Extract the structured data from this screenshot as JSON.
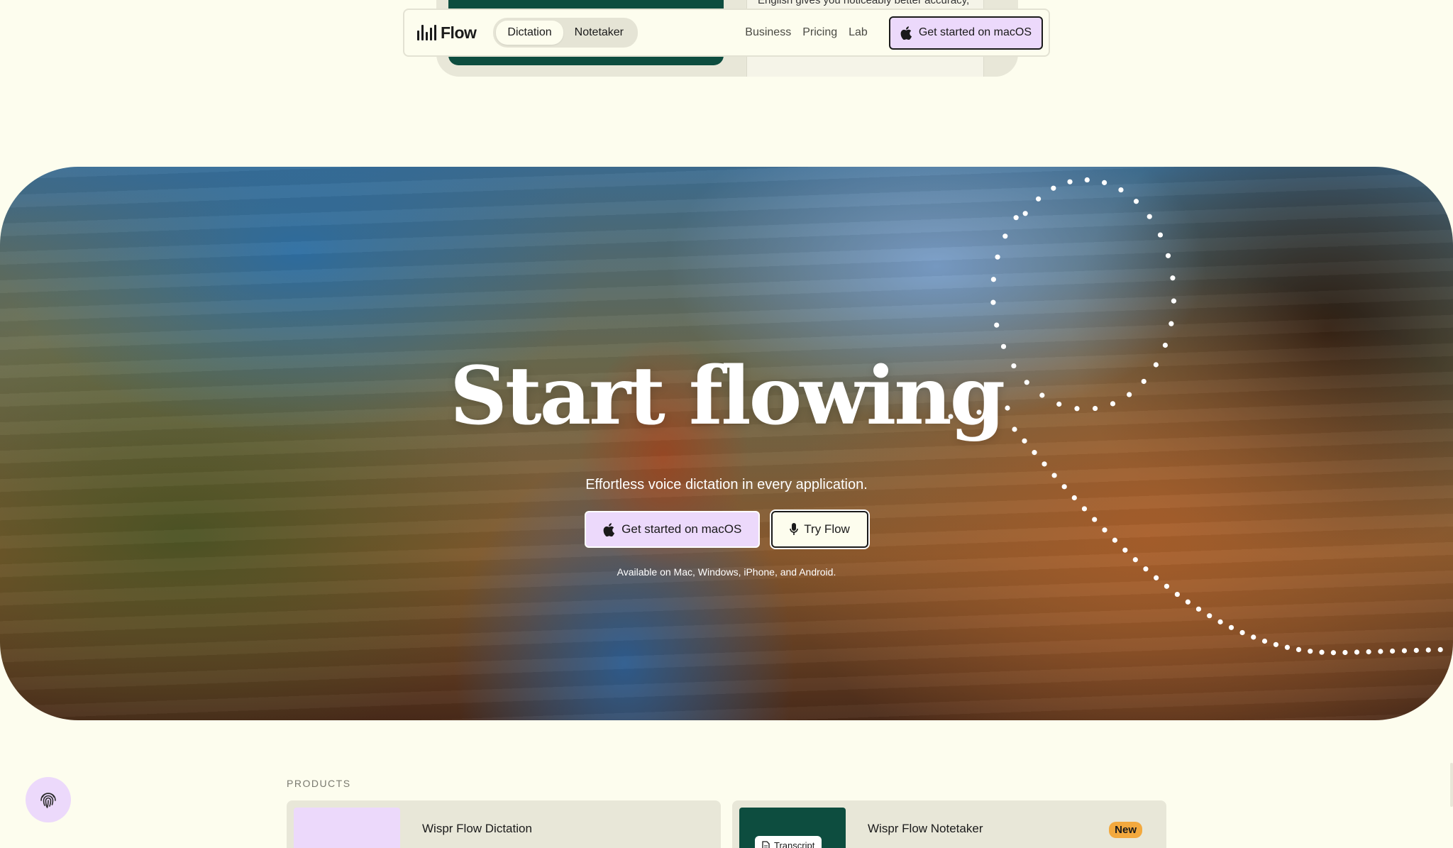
{
  "peek": {
    "doc_text": "English gives you noticeably better accuracy,"
  },
  "nav": {
    "logo_text": "Flow",
    "segments": [
      "Dictation",
      "Notetaker"
    ],
    "active_segment": "Dictation",
    "links": [
      "Business",
      "Pricing",
      "Lab"
    ],
    "cta_label": "Get started on macOS"
  },
  "hero": {
    "title": "Start flowing",
    "subtitle": "Effortless voice dictation in every application.",
    "primary_button": "Get started on macOS",
    "secondary_button": "Try Flow",
    "availability": "Available on Mac, Windows, iPhone, and Android."
  },
  "products": {
    "label": "PRODUCTS",
    "items": [
      {
        "title": "Wispr Flow Dictation"
      },
      {
        "title": "Wispr Flow Notetaker",
        "badge": "New",
        "chip": "Transcript"
      }
    ]
  },
  "colors": {
    "background": "#fdfdee",
    "accent_purple": "#ecd9fb",
    "brand_green": "#0d4d3f",
    "badge_orange": "#f3a93e"
  },
  "icons": {
    "apple": "apple-icon",
    "mic": "microphone-icon",
    "fingerprint": "fingerprint-icon",
    "document": "document-icon",
    "logo": "waveform-logo-icon"
  }
}
